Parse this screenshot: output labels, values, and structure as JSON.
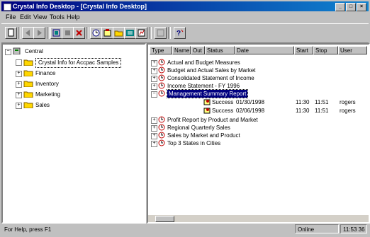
{
  "window": {
    "title": "Crystal Info Desktop - [Crystal Info Desktop]"
  },
  "menu": [
    "File",
    "Edit",
    "View",
    "Tools",
    "Help"
  ],
  "toolbar": {
    "icons": [
      "new-icon",
      "back-icon",
      "forward-icon",
      "refresh-icon",
      "stop-icon",
      "delete-icon",
      "schedule-icon",
      "properties-icon",
      "open-folder-icon",
      "report-icon",
      "run-icon",
      "tile-icon",
      "help-icon"
    ]
  },
  "tree": {
    "root": "Central",
    "items": [
      {
        "label": "Crystal Info for Accpac Samples",
        "expand": ""
      },
      {
        "label": "Finance",
        "expand": "+"
      },
      {
        "label": "Inventory",
        "expand": "+"
      },
      {
        "label": "Marketing",
        "expand": "+"
      },
      {
        "label": "Sales",
        "expand": "+"
      }
    ]
  },
  "list": {
    "columns": [
      "Type",
      "Name",
      "Out",
      "Status",
      "Date",
      "Start",
      "Stop",
      "User"
    ],
    "reports": [
      "Actual and Budget Measures",
      "Budget and Actual Sales by Market",
      "Consolidated Statement of Income",
      "Income Statement - FY 1996",
      "Management Summary Report",
      "Profit Report by Product and Market",
      "Regional Quarterly Sales",
      "Sales by Market and Product",
      "Top 3 States in Cities"
    ],
    "instances": [
      {
        "status": "Success",
        "date": "01/30/1998",
        "start": "11:30",
        "stop": "11:51",
        "user": "rogers"
      },
      {
        "status": "Success",
        "date": "02/06/1998",
        "start": "11:30",
        "stop": "11:51",
        "user": "rogers"
      }
    ]
  },
  "status": {
    "help": "For Help, press F1",
    "state": "Online",
    "time": "11:53 36"
  }
}
